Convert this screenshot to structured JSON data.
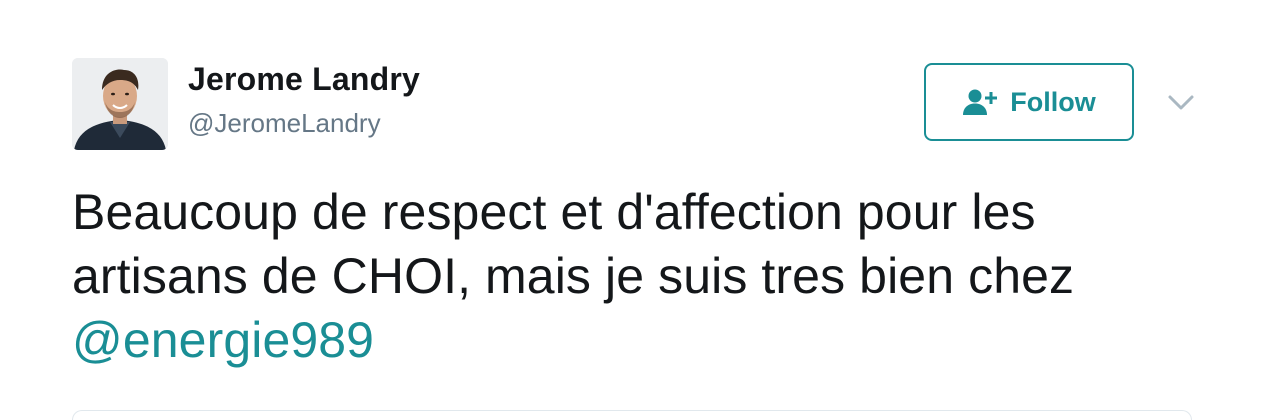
{
  "user": {
    "name": "Jerome Landry",
    "handle": "@JeromeLandry"
  },
  "follow_button": {
    "label": "Follow",
    "icon": "add-user-icon",
    "color": "#1a8e95"
  },
  "more_menu": {
    "icon": "chevron-down-icon"
  },
  "tweet": {
    "line1": "Beaucoup de respect et d'affection pour les",
    "line2": "artisans de CHOI, mais je suis tres bien chez",
    "mention": "@energie989"
  },
  "colors": {
    "accent": "#1a8e95",
    "text": "#14171a",
    "muted": "#657786",
    "border": "#e1e8ed"
  }
}
